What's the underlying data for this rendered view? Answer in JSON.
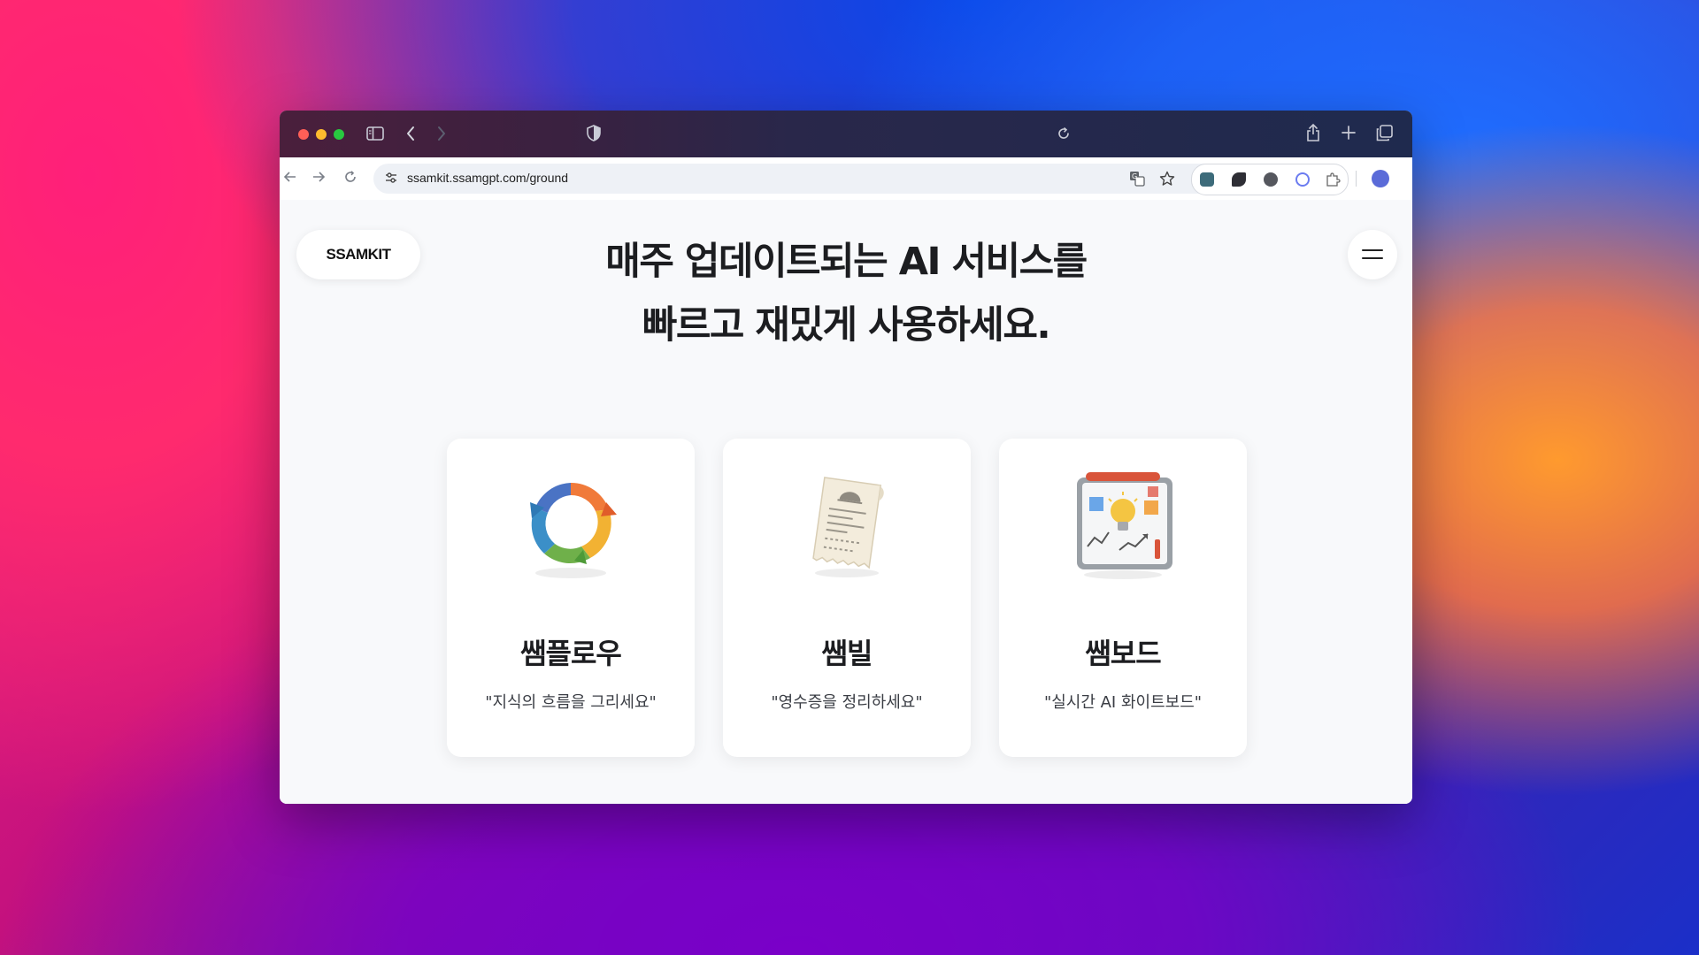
{
  "browser": {
    "url": "ssamkit.ssamgpt.com/ground",
    "icons": [
      "sidebar-icon",
      "back-icon",
      "forward-icon",
      "shield-icon",
      "reload-icon",
      "share-icon",
      "new-tab-icon",
      "tabs-overview-icon"
    ]
  },
  "site": {
    "logo": "SSAMKIT",
    "headline_line1": "매주 업데이트되는 AI 서비스를",
    "headline_line2": "빠르고 재밌게 사용하세요."
  },
  "cards": [
    {
      "title": "쌤플로우",
      "desc": "\"지식의 흐름을 그리세요\"",
      "icon": "cycle-arrows-icon"
    },
    {
      "title": "쌤빌",
      "desc": "\"영수증을 정리하세요\"",
      "icon": "receipt-icon"
    },
    {
      "title": "쌤보드",
      "desc": "\"실시간 AI 화이트보드\"",
      "icon": "whiteboard-icon"
    }
  ],
  "colors": {
    "page_bg": "#f8f9fb",
    "card_bg": "#ffffff",
    "text_primary": "#1c1d20"
  }
}
